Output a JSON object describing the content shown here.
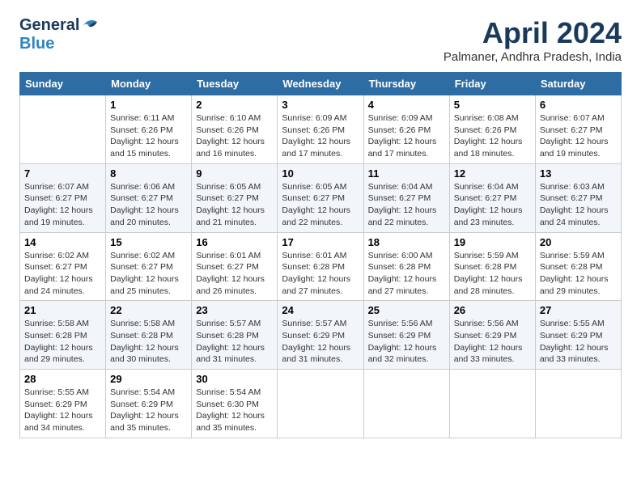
{
  "header": {
    "logo_general": "General",
    "logo_blue": "Blue",
    "month_year": "April 2024",
    "location": "Palmaner, Andhra Pradesh, India"
  },
  "days_of_week": [
    "Sunday",
    "Monday",
    "Tuesday",
    "Wednesday",
    "Thursday",
    "Friday",
    "Saturday"
  ],
  "weeks": [
    [
      {
        "day": "",
        "sunrise": "",
        "sunset": "",
        "daylight": ""
      },
      {
        "day": "1",
        "sunrise": "Sunrise: 6:11 AM",
        "sunset": "Sunset: 6:26 PM",
        "daylight": "Daylight: 12 hours and 15 minutes."
      },
      {
        "day": "2",
        "sunrise": "Sunrise: 6:10 AM",
        "sunset": "Sunset: 6:26 PM",
        "daylight": "Daylight: 12 hours and 16 minutes."
      },
      {
        "day": "3",
        "sunrise": "Sunrise: 6:09 AM",
        "sunset": "Sunset: 6:26 PM",
        "daylight": "Daylight: 12 hours and 17 minutes."
      },
      {
        "day": "4",
        "sunrise": "Sunrise: 6:09 AM",
        "sunset": "Sunset: 6:26 PM",
        "daylight": "Daylight: 12 hours and 17 minutes."
      },
      {
        "day": "5",
        "sunrise": "Sunrise: 6:08 AM",
        "sunset": "Sunset: 6:26 PM",
        "daylight": "Daylight: 12 hours and 18 minutes."
      },
      {
        "day": "6",
        "sunrise": "Sunrise: 6:07 AM",
        "sunset": "Sunset: 6:27 PM",
        "daylight": "Daylight: 12 hours and 19 minutes."
      }
    ],
    [
      {
        "day": "7",
        "sunrise": "Sunrise: 6:07 AM",
        "sunset": "Sunset: 6:27 PM",
        "daylight": "Daylight: 12 hours and 19 minutes."
      },
      {
        "day": "8",
        "sunrise": "Sunrise: 6:06 AM",
        "sunset": "Sunset: 6:27 PM",
        "daylight": "Daylight: 12 hours and 20 minutes."
      },
      {
        "day": "9",
        "sunrise": "Sunrise: 6:05 AM",
        "sunset": "Sunset: 6:27 PM",
        "daylight": "Daylight: 12 hours and 21 minutes."
      },
      {
        "day": "10",
        "sunrise": "Sunrise: 6:05 AM",
        "sunset": "Sunset: 6:27 PM",
        "daylight": "Daylight: 12 hours and 22 minutes."
      },
      {
        "day": "11",
        "sunrise": "Sunrise: 6:04 AM",
        "sunset": "Sunset: 6:27 PM",
        "daylight": "Daylight: 12 hours and 22 minutes."
      },
      {
        "day": "12",
        "sunrise": "Sunrise: 6:04 AM",
        "sunset": "Sunset: 6:27 PM",
        "daylight": "Daylight: 12 hours and 23 minutes."
      },
      {
        "day": "13",
        "sunrise": "Sunrise: 6:03 AM",
        "sunset": "Sunset: 6:27 PM",
        "daylight": "Daylight: 12 hours and 24 minutes."
      }
    ],
    [
      {
        "day": "14",
        "sunrise": "Sunrise: 6:02 AM",
        "sunset": "Sunset: 6:27 PM",
        "daylight": "Daylight: 12 hours and 24 minutes."
      },
      {
        "day": "15",
        "sunrise": "Sunrise: 6:02 AM",
        "sunset": "Sunset: 6:27 PM",
        "daylight": "Daylight: 12 hours and 25 minutes."
      },
      {
        "day": "16",
        "sunrise": "Sunrise: 6:01 AM",
        "sunset": "Sunset: 6:27 PM",
        "daylight": "Daylight: 12 hours and 26 minutes."
      },
      {
        "day": "17",
        "sunrise": "Sunrise: 6:01 AM",
        "sunset": "Sunset: 6:28 PM",
        "daylight": "Daylight: 12 hours and 27 minutes."
      },
      {
        "day": "18",
        "sunrise": "Sunrise: 6:00 AM",
        "sunset": "Sunset: 6:28 PM",
        "daylight": "Daylight: 12 hours and 27 minutes."
      },
      {
        "day": "19",
        "sunrise": "Sunrise: 5:59 AM",
        "sunset": "Sunset: 6:28 PM",
        "daylight": "Daylight: 12 hours and 28 minutes."
      },
      {
        "day": "20",
        "sunrise": "Sunrise: 5:59 AM",
        "sunset": "Sunset: 6:28 PM",
        "daylight": "Daylight: 12 hours and 29 minutes."
      }
    ],
    [
      {
        "day": "21",
        "sunrise": "Sunrise: 5:58 AM",
        "sunset": "Sunset: 6:28 PM",
        "daylight": "Daylight: 12 hours and 29 minutes."
      },
      {
        "day": "22",
        "sunrise": "Sunrise: 5:58 AM",
        "sunset": "Sunset: 6:28 PM",
        "daylight": "Daylight: 12 hours and 30 minutes."
      },
      {
        "day": "23",
        "sunrise": "Sunrise: 5:57 AM",
        "sunset": "Sunset: 6:28 PM",
        "daylight": "Daylight: 12 hours and 31 minutes."
      },
      {
        "day": "24",
        "sunrise": "Sunrise: 5:57 AM",
        "sunset": "Sunset: 6:29 PM",
        "daylight": "Daylight: 12 hours and 31 minutes."
      },
      {
        "day": "25",
        "sunrise": "Sunrise: 5:56 AM",
        "sunset": "Sunset: 6:29 PM",
        "daylight": "Daylight: 12 hours and 32 minutes."
      },
      {
        "day": "26",
        "sunrise": "Sunrise: 5:56 AM",
        "sunset": "Sunset: 6:29 PM",
        "daylight": "Daylight: 12 hours and 33 minutes."
      },
      {
        "day": "27",
        "sunrise": "Sunrise: 5:55 AM",
        "sunset": "Sunset: 6:29 PM",
        "daylight": "Daylight: 12 hours and 33 minutes."
      }
    ],
    [
      {
        "day": "28",
        "sunrise": "Sunrise: 5:55 AM",
        "sunset": "Sunset: 6:29 PM",
        "daylight": "Daylight: 12 hours and 34 minutes."
      },
      {
        "day": "29",
        "sunrise": "Sunrise: 5:54 AM",
        "sunset": "Sunset: 6:29 PM",
        "daylight": "Daylight: 12 hours and 35 minutes."
      },
      {
        "day": "30",
        "sunrise": "Sunrise: 5:54 AM",
        "sunset": "Sunset: 6:30 PM",
        "daylight": "Daylight: 12 hours and 35 minutes."
      },
      {
        "day": "",
        "sunrise": "",
        "sunset": "",
        "daylight": ""
      },
      {
        "day": "",
        "sunrise": "",
        "sunset": "",
        "daylight": ""
      },
      {
        "day": "",
        "sunrise": "",
        "sunset": "",
        "daylight": ""
      },
      {
        "day": "",
        "sunrise": "",
        "sunset": "",
        "daylight": ""
      }
    ]
  ]
}
